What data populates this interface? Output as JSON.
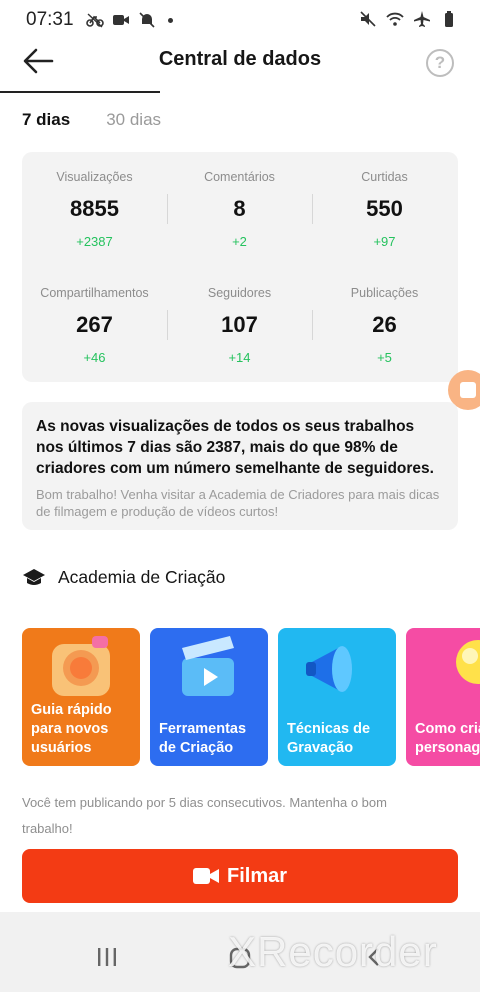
{
  "status_bar": {
    "time": "07:31"
  },
  "header": {
    "title": "Central de dados"
  },
  "tabs": [
    {
      "label": "7 dias"
    },
    {
      "label": "30 dias"
    }
  ],
  "stats": [
    {
      "label": "Visualizações",
      "value": "8855",
      "delta": "+2387"
    },
    {
      "label": "Comentários",
      "value": "8",
      "delta": "+2"
    },
    {
      "label": "Curtidas",
      "value": "550",
      "delta": "+97"
    },
    {
      "label": "Compartilhamentos",
      "value": "267",
      "delta": "+46"
    },
    {
      "label": "Seguidores",
      "value": "107",
      "delta": "+14"
    },
    {
      "label": "Publicações",
      "value": "26",
      "delta": "+5"
    }
  ],
  "info": {
    "part1": "As novas visualizações de todos os seus trabalhos nos últimos 7 dias são ",
    "views": "2387",
    "part2": ", mais do que ",
    "percent": "98%",
    "part3": " de criadores com um número semelhante de seguidores.",
    "sub": "Bom trabalho! Venha visitar a Academia de Criadores para mais dicas de filmagem e produção de vídeos curtos!"
  },
  "academy": {
    "title": "Academia de Criação",
    "cards": [
      {
        "label": "Guia rápido\npara novos\nusuários"
      },
      {
        "label": "Ferramentas\nde Criação"
      },
      {
        "label": "Técnicas de\nGravação"
      },
      {
        "label": "Como cria\npersonag"
      }
    ]
  },
  "footer": {
    "streak_text": "Você tem publicando por 5 dias consecutivos. Mantenha o bom trabalho!",
    "film_button": "Filmar"
  },
  "watermark": "XRecorder"
}
